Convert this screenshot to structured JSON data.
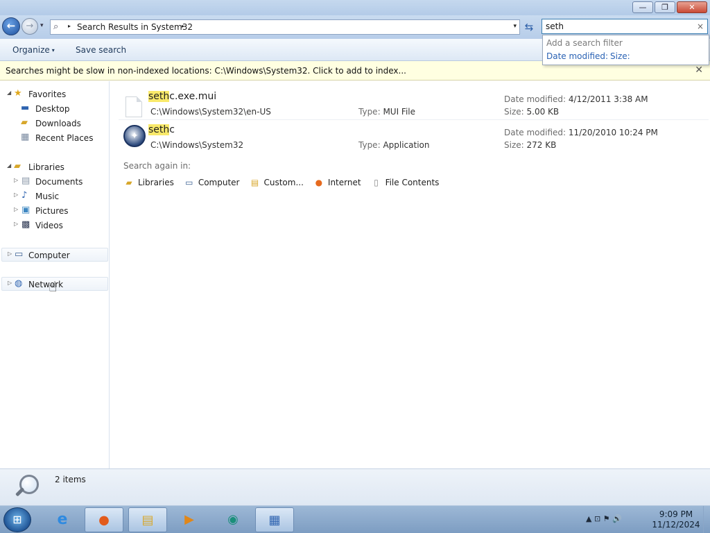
{
  "window": {
    "minimize": "—",
    "maximize": "❐",
    "close": "✕"
  },
  "nav": {
    "back": "←",
    "forward": "→",
    "history": "▾",
    "address_icon": "⌕",
    "address_sep1": "▸",
    "address_text": "Search Results in System32",
    "address_sep2": "▸",
    "address_dropdown": "▾",
    "refresh": "⇆"
  },
  "search": {
    "value": "seth",
    "clear": "×"
  },
  "filter_popup": {
    "title": "Add a search filter",
    "date_modified": "Date modified:",
    "size": "Size:"
  },
  "toolbar": {
    "organize": "Organize",
    "organize_caret": "▾",
    "save_search": "Save search"
  },
  "infobar": {
    "text": "Searches might be slow in non-indexed locations: C:\\Windows\\System32. Click to add to index...",
    "close": "✕"
  },
  "navpane": {
    "favorites": "Favorites",
    "desktop": "Desktop",
    "downloads": "Downloads",
    "recent_places": "Recent Places",
    "libraries": "Libraries",
    "documents": "Documents",
    "music": "Music",
    "pictures": "Pictures",
    "videos": "Videos",
    "computer": "Computer",
    "network": "Network",
    "exp_open": "◢",
    "exp_closed": "▷"
  },
  "results": [
    {
      "match": "seth",
      "rest": "c.exe.mui",
      "path": "C:\\Windows\\System32\\en-US",
      "type_label": "Type:",
      "type": "MUI File",
      "date_label": "Date modified:",
      "date": "4/12/2011 3:38 AM",
      "size_label": "Size:",
      "size": "5.00 KB"
    },
    {
      "match": "seth",
      "rest": "c",
      "path": "C:\\Windows\\System32",
      "type_label": "Type:",
      "type": "Application",
      "date_label": "Date modified:",
      "date": "11/20/2010 10:24 PM",
      "size_label": "Size:",
      "size": "272 KB"
    }
  ],
  "search_again": {
    "title": "Search again in:",
    "libraries": "Libraries",
    "computer": "Computer",
    "custom": "Custom...",
    "internet": "Internet",
    "file_contents": "File Contents"
  },
  "details": {
    "count": "2 items"
  },
  "taskbar": {
    "start": "⊞",
    "ie": "e",
    "firefox": "●",
    "explorer": "▤",
    "media": "▶",
    "app": "◉",
    "control": "▦",
    "tray": "▲  ⊡  ⚑  🔊",
    "time": "9:09 PM",
    "date": "11/12/2024"
  },
  "colors": {
    "highlight": "#f9e96a",
    "link": "#2a62b4",
    "infobar": "#ffffe1"
  }
}
